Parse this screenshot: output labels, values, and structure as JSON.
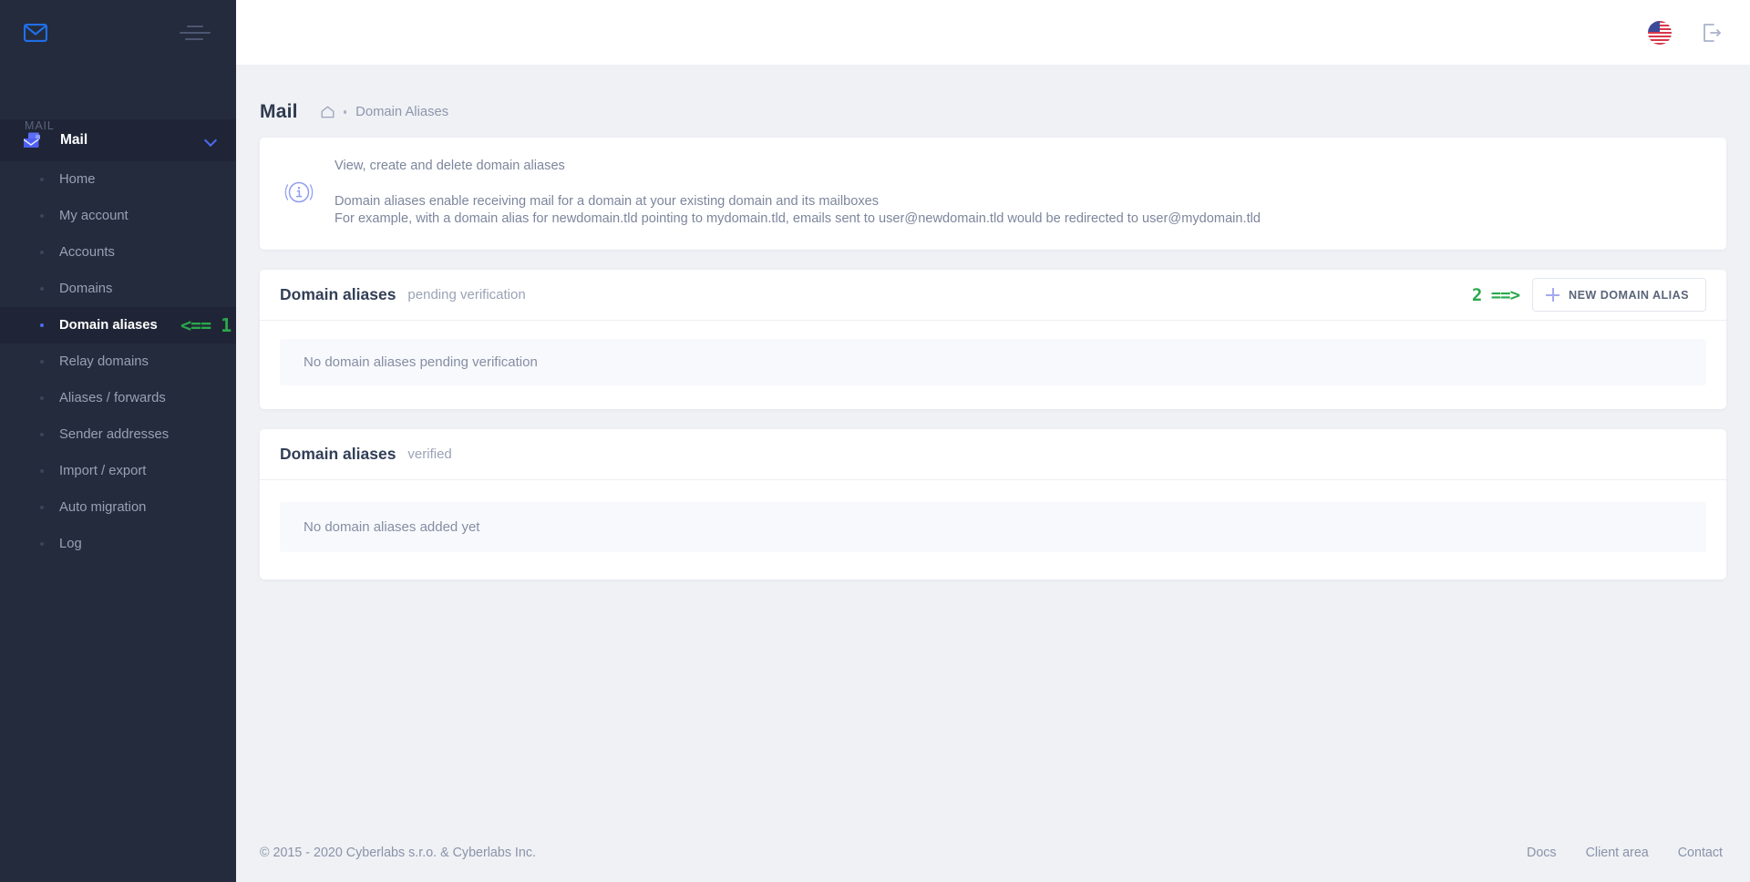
{
  "sidebar": {
    "logo_icon": "envelope-icon",
    "menu_toggle_icon": "hamburger-icon",
    "section_label": "MAIL",
    "group": {
      "icon": "mail-stack-icon",
      "label": "Mail",
      "chevron": "chevron-down-icon"
    },
    "items": [
      {
        "label": "Home",
        "active": false
      },
      {
        "label": "My account",
        "active": false
      },
      {
        "label": "Accounts",
        "active": false
      },
      {
        "label": "Domains",
        "active": false
      },
      {
        "label": "Domain aliases",
        "active": true,
        "annotation": "<== 1"
      },
      {
        "label": "Relay domains",
        "active": false
      },
      {
        "label": "Aliases / forwards",
        "active": false
      },
      {
        "label": "Sender addresses",
        "active": false
      },
      {
        "label": "Import / export",
        "active": false
      },
      {
        "label": "Auto migration",
        "active": false
      },
      {
        "label": "Log",
        "active": false
      }
    ]
  },
  "topbar": {
    "language_icon": "us-flag-icon",
    "logout_icon": "logout-icon"
  },
  "page": {
    "title": "Mail",
    "breadcrumb_home_icon": "home-icon",
    "breadcrumb_current": "Domain Aliases"
  },
  "alert": {
    "icon": "info-circle-icon",
    "heading": "View, create and delete domain aliases",
    "line1": "Domain aliases enable receiving mail for a domain at your existing domain and its mailboxes",
    "line2": "For example, with a domain alias for newdomain.tld pointing to mydomain.tld, emails sent to user@newdomain.tld would be redirected to user@mydomain.tld"
  },
  "pending_card": {
    "title": "Domain aliases",
    "subtitle": "pending verification",
    "annotation": "2 ==>",
    "button": {
      "icon": "plus-icon",
      "label": "NEW DOMAIN ALIAS"
    },
    "empty_text": "No domain aliases pending verification"
  },
  "verified_card": {
    "title": "Domain aliases",
    "subtitle": "verified",
    "empty_text": "No domain aliases added yet"
  },
  "footer": {
    "copyright": "© 2015 - 2020 Cyberlabs s.r.o. & Cyberlabs Inc.",
    "links": [
      {
        "label": "Docs"
      },
      {
        "label": "Client area"
      },
      {
        "label": "Contact"
      }
    ]
  },
  "colors": {
    "sidebar_bg": "#242b3d",
    "sidebar_active_bg": "#1f2536",
    "accent_blue": "#4e6cf0",
    "page_bg": "#eff1f5",
    "annotation_green": "#2aa84a",
    "plus_purple": "#a6a9f0"
  }
}
